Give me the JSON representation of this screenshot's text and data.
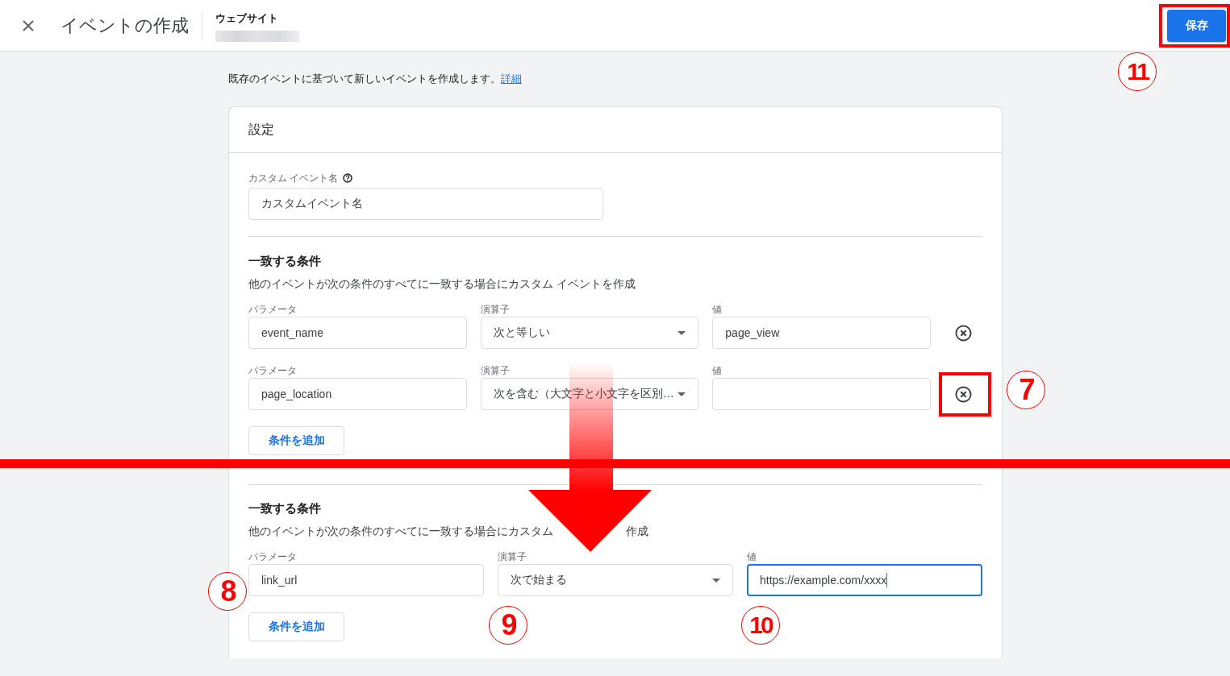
{
  "header": {
    "title": "イベントの作成",
    "property_label": "ウェブサイト",
    "save_button": {
      "label": "保存",
      "highlighted": true
    }
  },
  "intro": {
    "text": "既存のイベントに基づいて新しいイベントを作成します。",
    "link": "詳細"
  },
  "settings_card": {
    "title": "設定",
    "custom_event_name": {
      "label": "カスタム イベント名",
      "value": "カスタムイベント名"
    }
  },
  "conditions_before": {
    "title": "一致する条件",
    "description": "他のイベントが次の条件のすべてに一致する場合にカスタム イベントを作成",
    "rows": [
      {
        "parameter_label": "パラメータ",
        "parameter": "event_name",
        "operator_label": "演算子",
        "operator": "次と等しい",
        "value_label": "値",
        "value": "page_view",
        "focused": false,
        "removable": true
      },
      {
        "parameter_label": "パラメータ",
        "parameter": "page_location",
        "operator_label": "演算子",
        "operator": "次を含む（大文字と小文字を区別…",
        "value_label": "値",
        "focused": false,
        "removable": true,
        "remove_highlighted": true
      }
    ],
    "add_button": "条件を追加"
  },
  "conditions_after": {
    "title": "一致する条件",
    "description_parts": [
      "他のイベントが次の条件のすべてに一致する場合にカスタム",
      "作成"
    ],
    "rows": [
      {
        "parameter_label": "パラメータ",
        "parameter": "link_url",
        "operator_label": "演算子",
        "operator": "次で始まる",
        "value_label": "値",
        "value": "https://example.com/xxxx",
        "focused": true
      }
    ],
    "add_button": "条件を追加"
  },
  "annotations": {
    "markers": [
      {
        "number": "11"
      },
      {
        "number": "7"
      },
      {
        "number": "8"
      },
      {
        "number": "9"
      },
      {
        "number": "10"
      }
    ]
  }
}
